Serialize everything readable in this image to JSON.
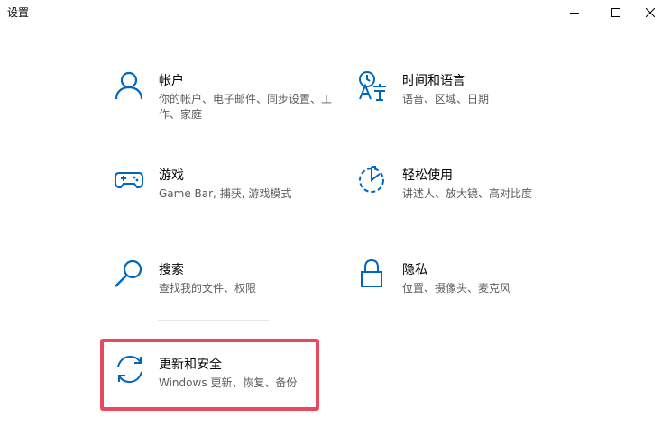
{
  "window": {
    "title": "设置",
    "controls": {
      "minimize": "minimize-icon",
      "maximize": "maximize-icon",
      "close": "close-icon"
    }
  },
  "accent_color": "#0067c0",
  "highlight_color": "#e8495e",
  "tiles": [
    {
      "name": "帐户",
      "desc": "你的帐户、电子邮件、同步设置、工作、家庭",
      "icon": "person-icon"
    },
    {
      "name": "时间和语言",
      "desc": "语音、区域、日期",
      "icon": "time-language-icon"
    },
    {
      "name": "游戏",
      "desc": "Game Bar, 捕获, 游戏模式",
      "icon": "gamepad-icon"
    },
    {
      "name": "轻松使用",
      "desc": "讲述人、放大镜、高对比度",
      "icon": "ease-of-access-icon"
    },
    {
      "name": "搜索",
      "desc": "查找我的文件、权限",
      "icon": "search-icon"
    },
    {
      "name": "隐私",
      "desc": "位置、摄像头、麦克风",
      "icon": "lock-icon"
    },
    {
      "name": "更新和安全",
      "desc": "Windows 更新、恢复、备份",
      "icon": "sync-icon"
    }
  ]
}
